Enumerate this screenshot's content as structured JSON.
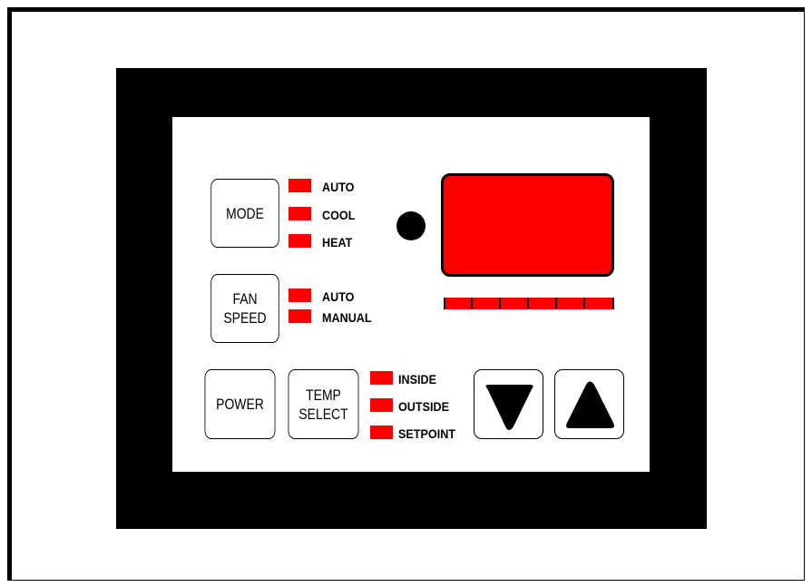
{
  "controls": {
    "mode_button": "MODE",
    "fan_speed_button": [
      "FAN",
      "SPEED"
    ],
    "power_button": "POWER",
    "temp_select_button": [
      "TEMP",
      "SELECT"
    ],
    "down_button_icon": "down-triangle-icon",
    "up_button_icon": "up-triangle-icon"
  },
  "indicators": {
    "mode": [
      "AUTO",
      "COOL",
      "HEAT"
    ],
    "fan": [
      "AUTO",
      "MANUAL"
    ],
    "temp": [
      "INSIDE",
      "OUTSIDE",
      "SETPOINT"
    ]
  },
  "colors": {
    "led": "#ff0000",
    "bezel": "#000000",
    "panel": "#ffffff"
  }
}
